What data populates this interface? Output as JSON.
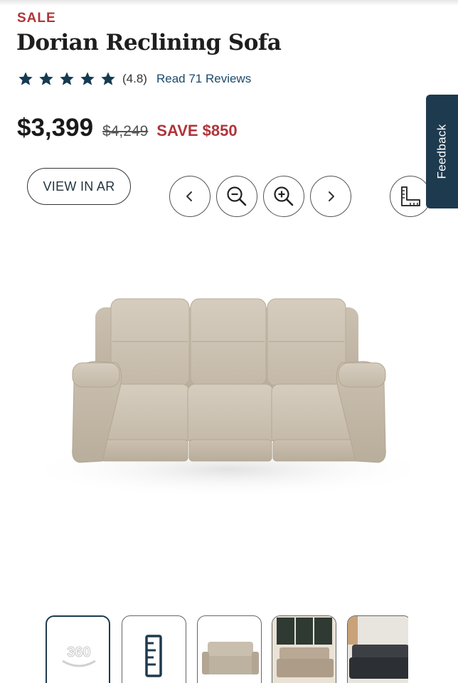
{
  "product": {
    "badge": "SALE",
    "title": "Dorian Reclining Sofa",
    "rating": {
      "stars": 5,
      "value_text": "(4.8)",
      "reviews_link": "Read 71 Reviews"
    },
    "price": {
      "current": "$3,399",
      "original": "$4,249",
      "savings": "SAVE $850"
    }
  },
  "actions": {
    "view_in_ar": "VIEW IN AR"
  },
  "viewer_controls": [
    {
      "name": "previous-icon"
    },
    {
      "name": "zoom-out-icon"
    },
    {
      "name": "zoom-in-icon"
    },
    {
      "name": "next-icon"
    },
    {
      "name": "dimensions-icon"
    }
  ],
  "feedback": {
    "label": "Feedback"
  },
  "gallery": {
    "thumbnails": [
      {
        "name": "360-view",
        "label": "360"
      },
      {
        "name": "dimensions-ruler"
      },
      {
        "name": "sofa-front-view"
      },
      {
        "name": "sofa-room-scene"
      },
      {
        "name": "sofa-dark-leather-scene"
      }
    ]
  },
  "colors": {
    "sale_red": "#b0343a",
    "navy": "#1e3a4e",
    "star": "#163a52",
    "fabric": "#cfc5b5"
  }
}
